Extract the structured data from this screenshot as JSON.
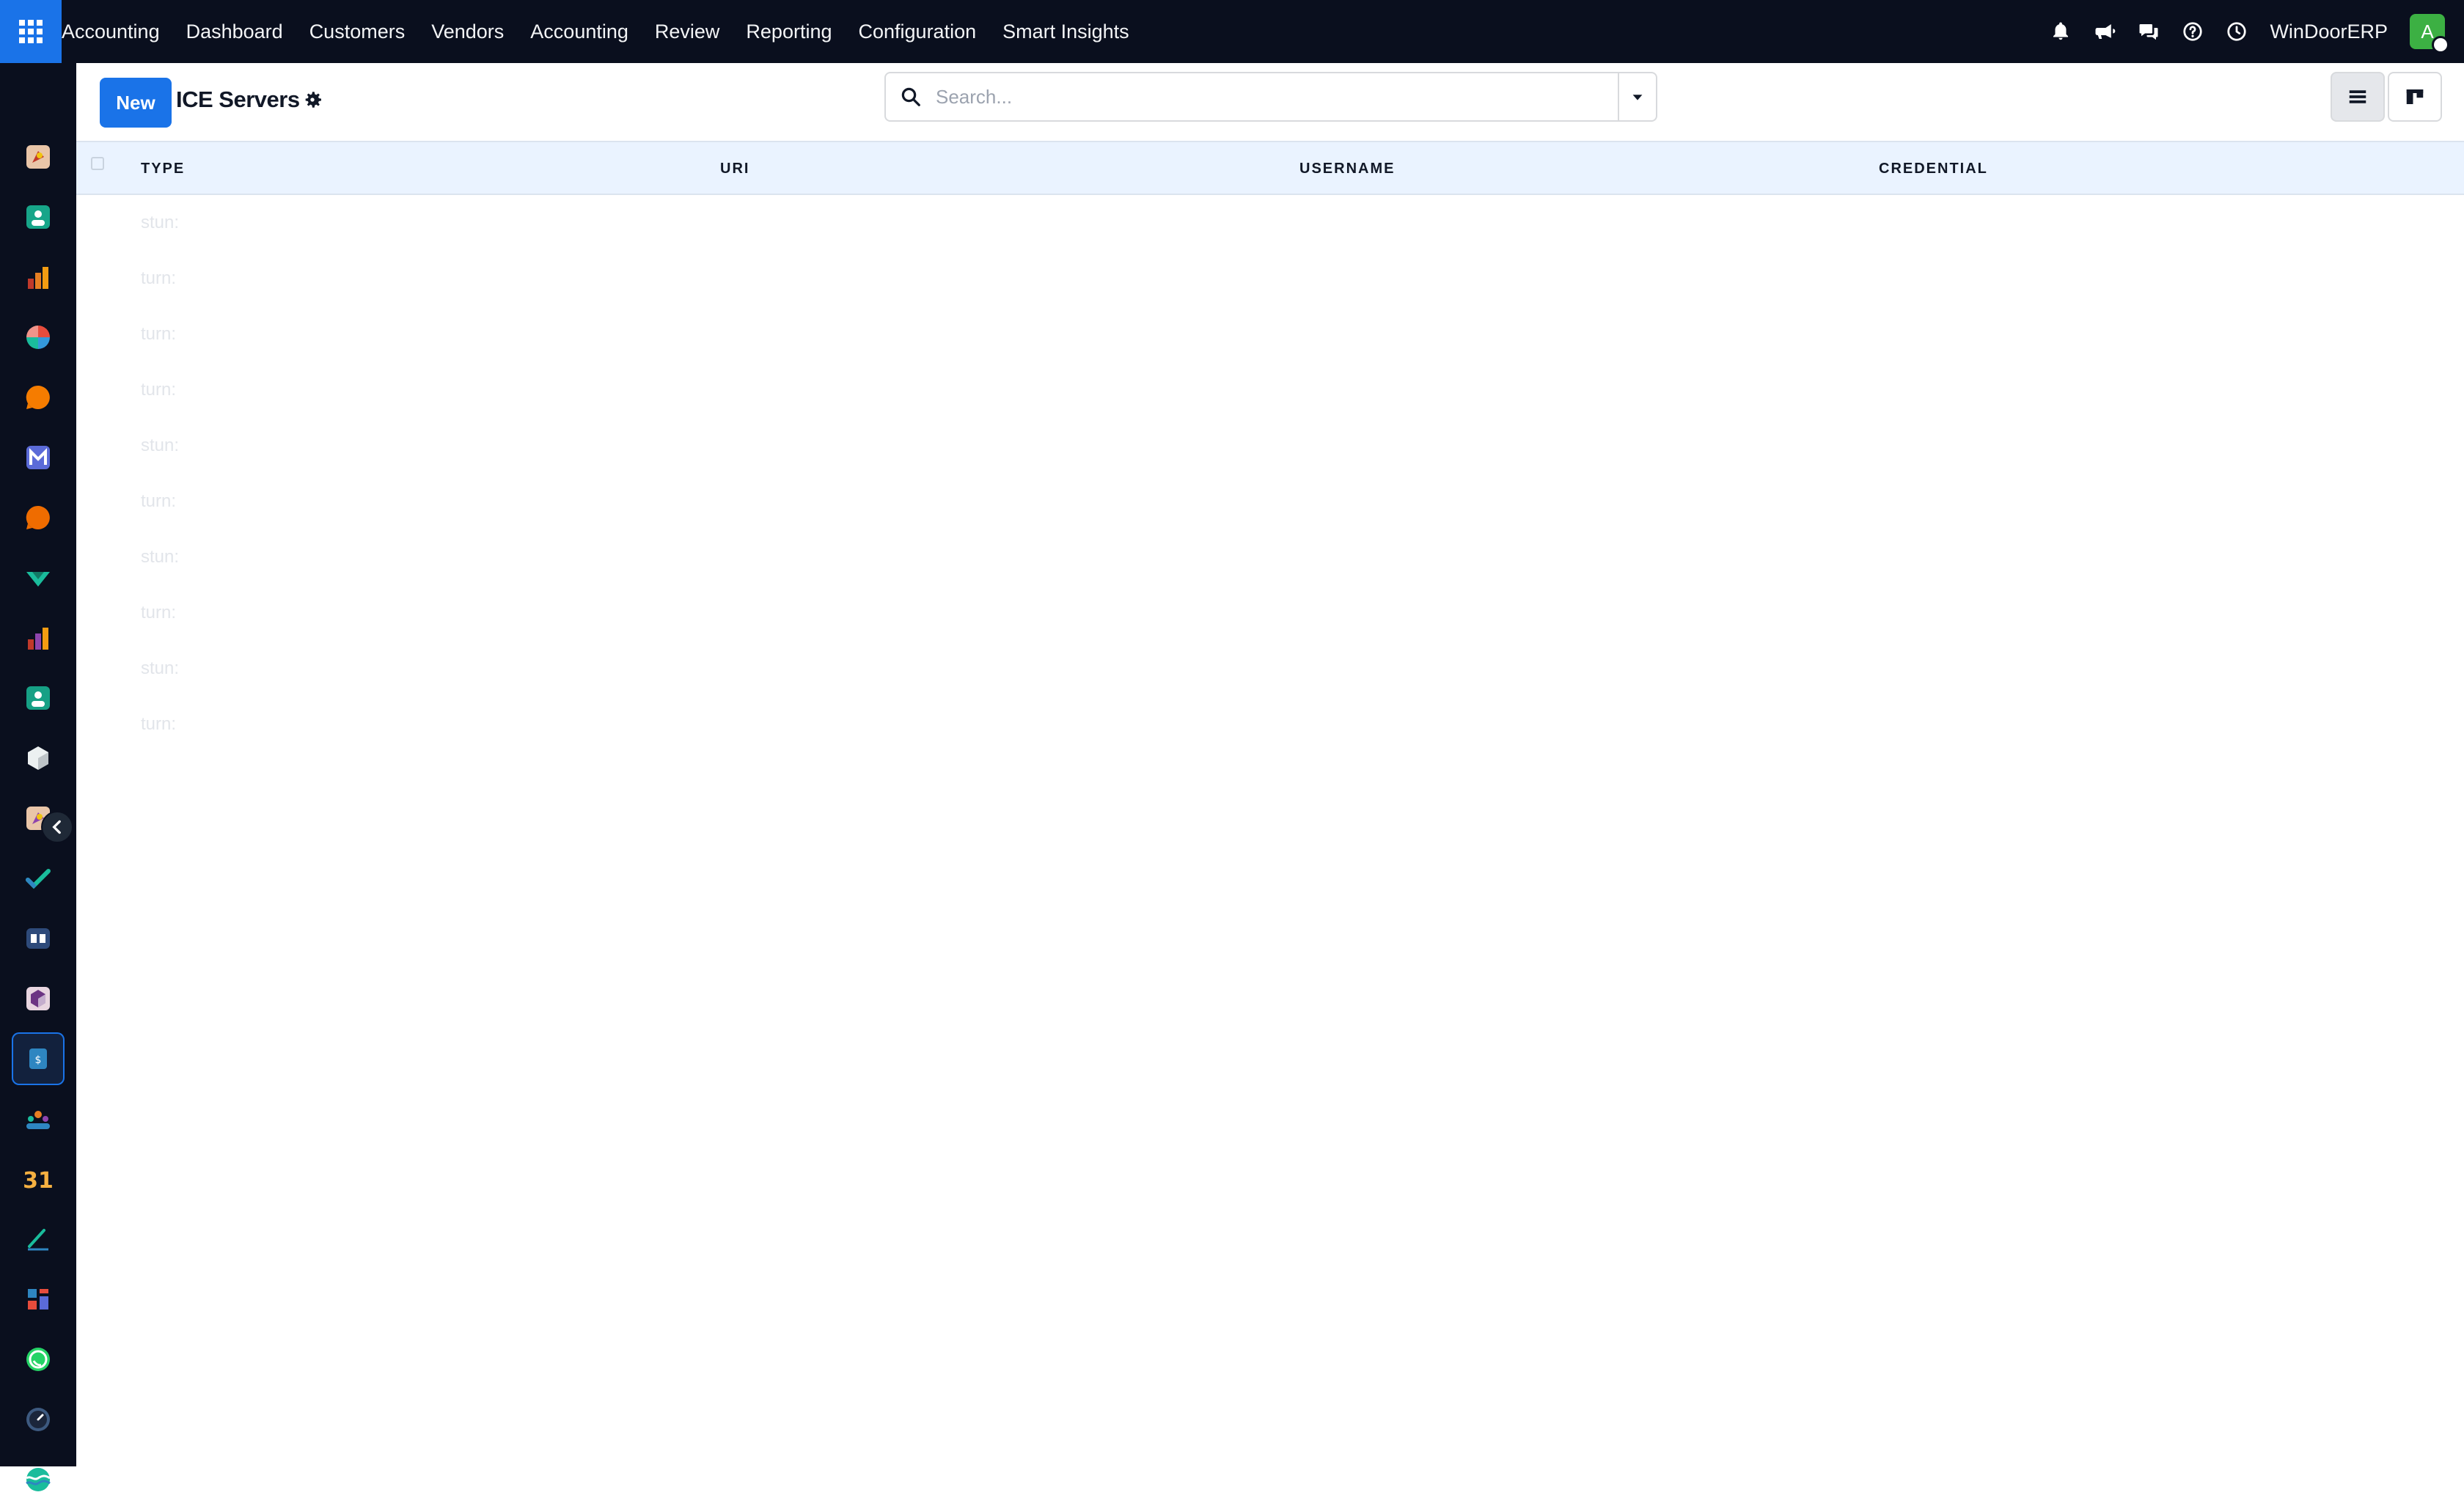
{
  "navbar": {
    "brand": "Accounting",
    "menu": [
      "Dashboard",
      "Customers",
      "Vendors",
      "Accounting",
      "Review",
      "Reporting",
      "Configuration",
      "Smart Insights"
    ],
    "company": "WinDoorERP",
    "avatar_initial": "A",
    "tray_icons": [
      "bell-icon",
      "megaphone-icon",
      "chat-icon",
      "help-icon",
      "clock-icon"
    ]
  },
  "sidebar": {
    "apps": [
      "rocket-app-icon",
      "contacts-app-icon",
      "bar-chart-app-icon",
      "pie-app-icon",
      "discuss-app-icon",
      "email-app-icon",
      "livechat-app-icon",
      "check-banner-app-icon",
      "reporting-app-icon",
      "employee-app-icon",
      "inventory-app-icon",
      "rocket-app-icon",
      "todo-app-icon",
      "knowledge-app-icon",
      "package-app-icon",
      "invoicing-app-icon",
      "team-app-icon",
      "calendar-app-icon",
      "sign-app-icon",
      "dashboard-app-icon",
      "whatsapp-app-icon",
      "timer-app-icon",
      "wave-app-icon"
    ],
    "calendar_label": "31",
    "active_index": 15
  },
  "control": {
    "new_label": "New",
    "title": "ICE Servers",
    "search_placeholder": "Search..."
  },
  "table": {
    "columns": [
      "TYPE",
      "URI",
      "USERNAME",
      "CREDENTIAL"
    ],
    "rows": [
      {
        "type": "stun:"
      },
      {
        "type": "turn:"
      },
      {
        "type": "turn:"
      },
      {
        "type": "turn:"
      },
      {
        "type": "stun:"
      },
      {
        "type": "turn:"
      },
      {
        "type": "stun:"
      },
      {
        "type": "turn:"
      },
      {
        "type": "stun:"
      },
      {
        "type": "turn:"
      }
    ]
  },
  "colors": {
    "navbar_bg": "#0a0f1e",
    "accent": "#1a73e8",
    "header_bg": "#eaf3ff",
    "avatar": "#3cb043"
  }
}
